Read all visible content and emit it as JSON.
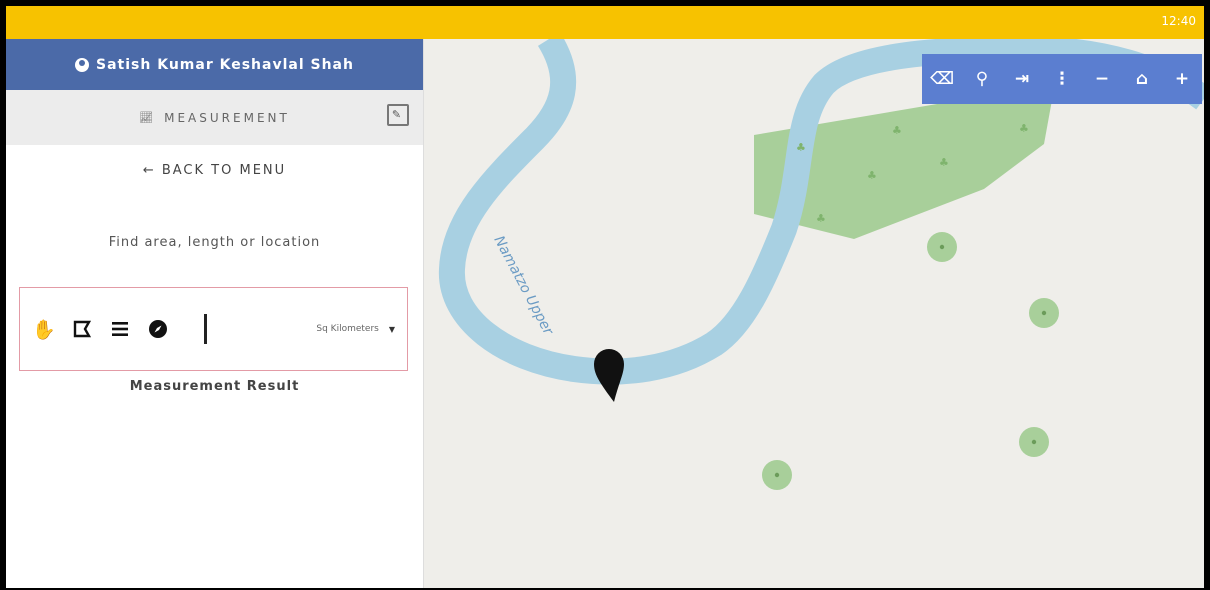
{
  "status_bar": {
    "time": "12:40"
  },
  "sidebar": {
    "user_name": "Satish Kumar Keshavlal Shah",
    "section_title": "MEASUREMENT",
    "back_label": "← BACK TO MENU",
    "description": "Find area, length or location",
    "tools": [
      {
        "icon": "hand-pan-icon"
      },
      {
        "icon": "area-polygon-icon"
      },
      {
        "icon": "length-line-icon"
      },
      {
        "icon": "location-compass-icon"
      }
    ],
    "units_value": "Sq Kilometers",
    "result_label": "Measurement Result"
  },
  "map": {
    "river_label": "Namatzo Upper",
    "controls": [
      "eraser-icon",
      "zoom-search-icon",
      "export-icon",
      "more-vert-icon",
      "zoom-out-icon",
      "home-icon",
      "zoom-in-icon"
    ],
    "colors": {
      "river": "#a8d0e2",
      "park": "#a8cf9a",
      "background": "#efeeea",
      "controls": "#5b7ed0"
    }
  },
  "colors": {
    "status_bar": "#f7c200",
    "user_bar": "#4b6aa8",
    "tool_border": "#e39ba6"
  }
}
